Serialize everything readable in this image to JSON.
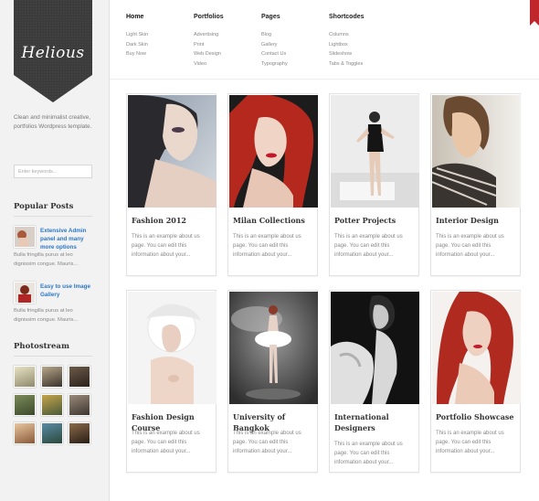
{
  "brand": {
    "logo_text": "Helious",
    "tagline": "Clean and minimalist creative, portfolios Wordpress template."
  },
  "search": {
    "placeholder": "Enter keywords..."
  },
  "nav": [
    {
      "label": "Home",
      "items": [
        "Light Skin",
        "Dark Skin",
        "Buy Now"
      ]
    },
    {
      "label": "Portfolios",
      "items": [
        "Advertising",
        "Print",
        "Web Design",
        "Video"
      ]
    },
    {
      "label": "Pages",
      "items": [
        "Blog",
        "Gallery",
        "Contact Us",
        "Typography"
      ]
    },
    {
      "label": "Shortcodes",
      "items": [
        "Columns",
        "Lightbox",
        "Slideshow",
        "Tabs & Toggles"
      ]
    }
  ],
  "popular_posts": {
    "heading": "Popular Posts",
    "posts": [
      {
        "title": "Extensive Admin panel and many more options",
        "excerpt": "Bulla fringilla purus at leo dignissim congue. Mauris..."
      },
      {
        "title": "Easy to use Image Gallery",
        "excerpt": "Bulla fringilla purus at leo dignissim congue. Mauris..."
      }
    ]
  },
  "photostream": {
    "heading": "Photostream"
  },
  "portfolio": [
    {
      "title": "Fashion 2012",
      "desc": "This is an example about us page. You can edit this information about your..."
    },
    {
      "title": "Milan Collections",
      "desc": "This is an example about us page. You can edit this information about your..."
    },
    {
      "title": "Potter Projects",
      "desc": "This is an example about us page. You can edit this information about your..."
    },
    {
      "title": "Interior Design",
      "desc": "This is an example about us page. You can edit this information about your..."
    },
    {
      "title": "Fashion Design Course",
      "desc": "This is an example about us page. You can edit this information about your..."
    },
    {
      "title": "University of Bangkok",
      "desc": "This is an example about us page. You can edit this information about your..."
    },
    {
      "title": "International Designers",
      "desc": "This is an example about us page. You can edit this information about your..."
    },
    {
      "title": "Portfolio Showcase",
      "desc": "This is an example about us page. You can edit this information about your..."
    }
  ],
  "colors": {
    "accent_link": "#2b78c5",
    "ribbon": "#3d3d3d",
    "corner_ribbon": "#c0272d"
  }
}
